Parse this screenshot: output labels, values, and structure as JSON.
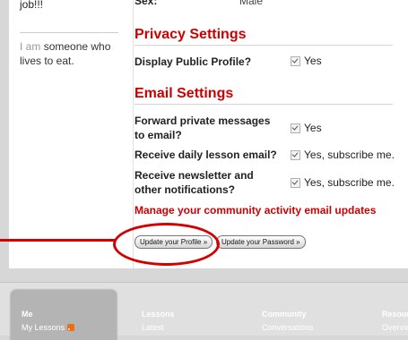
{
  "sidebar": {
    "bio_tail": "job!!!",
    "bio_prefix": "I am",
    "bio_rest": "someone who lives to eat."
  },
  "profile": {
    "sex_label": "Sex:",
    "sex_value": "Male"
  },
  "privacy": {
    "title": "Privacy Settings",
    "display_profile_label": "Display Public Profile?",
    "display_profile_value": "Yes"
  },
  "email": {
    "title": "Email Settings",
    "forward_label": "Forward private messages to email?",
    "forward_value": "Yes",
    "daily_label": "Receive daily lesson email?",
    "daily_value": "Yes, subscribe me.",
    "newsletter_label": "Receive newsletter and other notifications?",
    "newsletter_value": "Yes, subscribe me.",
    "manage_link": "Manage your community activity email updates"
  },
  "buttons": {
    "update_profile": "Update your Profile »",
    "update_password": "Update your Password »"
  },
  "footer": {
    "col1_title": "Me",
    "col1_link": "My Lessons",
    "col2_title": "Lessons",
    "col2_link": "Latest",
    "col3_title": "Community",
    "col3_link": "Conversations",
    "col4_title": "Resour",
    "col4_link": "Overvie"
  },
  "colors": {
    "accent": "#cc0000",
    "annotation": "#d40000"
  }
}
